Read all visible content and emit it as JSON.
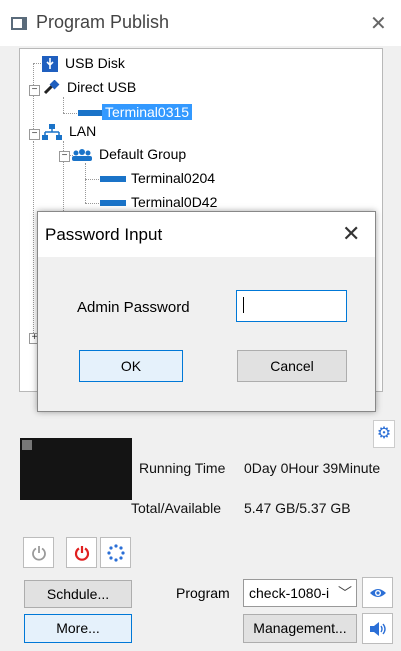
{
  "window": {
    "title": "Program Publish"
  },
  "tree": {
    "usb_disk": "USB Disk",
    "direct_usb": "Direct USB",
    "direct_terminal": "Terminal0315",
    "lan": "LAN",
    "default_group": "Default Group",
    "terminal_a": "Terminal0204",
    "terminal_b": "Terminal0D42"
  },
  "dialog": {
    "title": "Password Input",
    "label": "Admin Password",
    "password_value": "",
    "ok": "OK",
    "cancel": "Cancel"
  },
  "info": {
    "running_label": "Running Time",
    "running_value": "0Day 0Hour 39Minute",
    "storage_label": "Total/Available",
    "storage_value": "5.47 GB/5.37 GB"
  },
  "buttons": {
    "schedule": "Schdule...",
    "more": "More...",
    "program_label": "Program",
    "program_value": "check-1080-i",
    "management": "Management..."
  },
  "colors": {
    "selection": "#3399ff",
    "terminal_icon": "#1a73c8",
    "power_red": "#e02020",
    "accent_blue": "#2b6fd6"
  },
  "icons": [
    "window-icon",
    "close-icon",
    "usb-disk-icon",
    "usb-cable-icon",
    "terminal-icon",
    "network-icon",
    "group-icon",
    "power-icon",
    "power-off-icon",
    "restart-icon",
    "eye-icon",
    "speaker-icon",
    "gear-icon"
  ]
}
